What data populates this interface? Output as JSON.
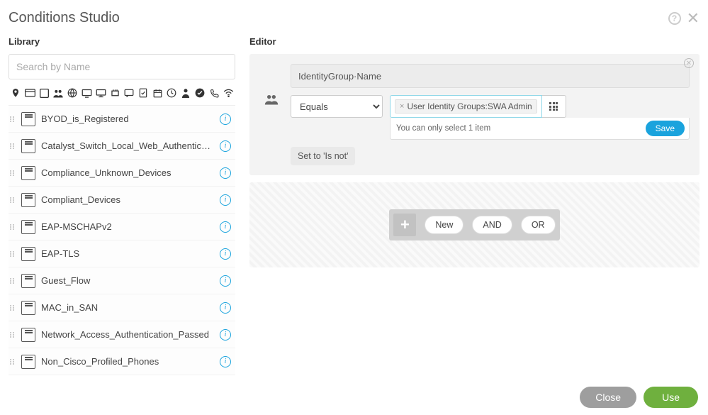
{
  "header": {
    "title": "Conditions Studio"
  },
  "library": {
    "title": "Library",
    "search_placeholder": "Search by Name",
    "filter_icons": [
      "location-pin-icon",
      "card-icon",
      "device-box-icon",
      "users-icon",
      "globe-icon",
      "monitor-icon",
      "desktop-icon",
      "port-icon",
      "message-icon",
      "check-doc-icon",
      "calendar-icon",
      "clock-icon",
      "person-icon",
      "check-circle-icon",
      "phone-icon",
      "wifi-icon"
    ],
    "items": [
      {
        "name": "BYOD_is_Registered"
      },
      {
        "name": "Catalyst_Switch_Local_Web_Authentication"
      },
      {
        "name": "Compliance_Unknown_Devices"
      },
      {
        "name": "Compliant_Devices"
      },
      {
        "name": "EAP-MSCHAPv2"
      },
      {
        "name": "EAP-TLS"
      },
      {
        "name": "Guest_Flow"
      },
      {
        "name": "MAC_in_SAN"
      },
      {
        "name": "Network_Access_Authentication_Passed"
      },
      {
        "name": "Non_Cisco_Profiled_Phones"
      }
    ]
  },
  "editor": {
    "title": "Editor",
    "attribute": "IdentityGroup·Name",
    "operator": "Equals",
    "value_chip": "User Identity Groups:SWA Admin",
    "value_hint": "You can only select 1 item",
    "save_label": "Save",
    "set_isnot_label": "Set to 'Is not'",
    "logic": {
      "new_label": "New",
      "and_label": "AND",
      "or_label": "OR"
    }
  },
  "footer": {
    "close_label": "Close",
    "use_label": "Use"
  }
}
